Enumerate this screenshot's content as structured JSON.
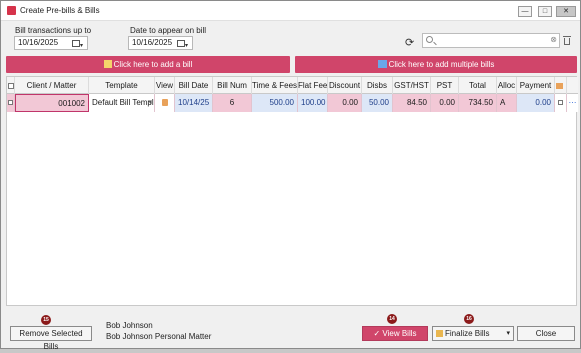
{
  "window": {
    "title": "Create Pre-bills & Bills",
    "minimize": "—",
    "maximize": "□",
    "close": "✕"
  },
  "filters": {
    "txn_label": "Bill transactions up to",
    "txn_date": "10/16/2025",
    "bill_date_label": "Date to appear on bill",
    "bill_date": "10/16/2025"
  },
  "toolbar": {
    "refresh_icon": "refresh-icon",
    "search_value": "",
    "clear": "⊗"
  },
  "actions": {
    "add_bill": "Click here to add a bill",
    "add_multiple": "Click here to add multiple bills"
  },
  "grid": {
    "columns": [
      "Client / Matter",
      "Template",
      "View",
      "Bill Date",
      "Bill Num",
      "Time & Fees",
      "Flat Fee",
      "Discount",
      "Disbs",
      "GST/HST",
      "PST",
      "Total",
      "Alloc",
      "Payment"
    ],
    "rows": [
      {
        "client_matter": "001002",
        "template": "Default  Bill  Templ...",
        "bill_date": "10/14/25",
        "bill_num": "6",
        "time_fees": "500.00",
        "flat_fee": "100.00",
        "discount": "0.00",
        "disbs": "50.00",
        "gst_hst": "84.50",
        "pst": "0.00",
        "total": "734.50",
        "alloc": "A",
        "payment": "0.00"
      }
    ]
  },
  "footer": {
    "remove_label": "Remove Selected Bills",
    "badge_remove": "15",
    "client_name": "Bob Johnson",
    "matter_name": "Bob Johnson Personal Matter",
    "badge_view": "14",
    "view_label": "View Bills",
    "view_check": "✓",
    "badge_finalize": "16",
    "finalize_label": "Finalize Bills",
    "close_label": "Close"
  },
  "colors": {
    "accent": "#d0456a",
    "selected_row": "#f2c8d6",
    "editable_cell": "#dde7f7"
  }
}
